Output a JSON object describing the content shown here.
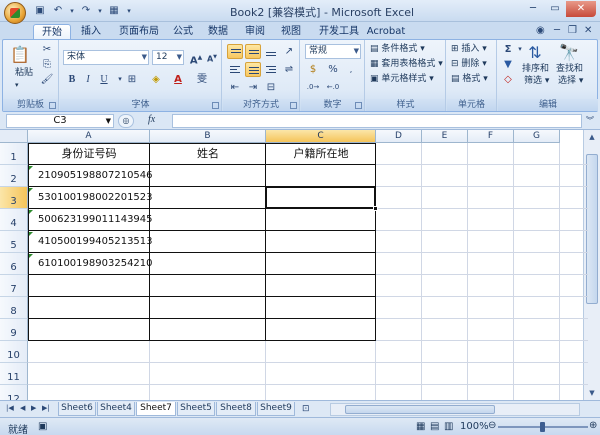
{
  "window": {
    "title": "Book2  [兼容模式] - Microsoft Excel"
  },
  "tabs": [
    "开始",
    "插入",
    "页面布局",
    "公式",
    "数据",
    "审阅",
    "视图",
    "开发工具",
    "Acrobat"
  ],
  "active_tab": "开始",
  "ribbon": {
    "clipboard": {
      "label": "剪贴板",
      "paste": "粘贴"
    },
    "font": {
      "label": "字体",
      "name": "宋体",
      "size": "12",
      "wen": "雯"
    },
    "alignment": {
      "label": "对齐方式"
    },
    "number": {
      "label": "数字",
      "format": "常规",
      "percent": "%"
    },
    "styles": {
      "label": "样式",
      "conditional": "条件格式",
      "table": "套用表格格式",
      "cell": "单元格样式"
    },
    "cells": {
      "label": "单元格",
      "insert": "插入",
      "delete": "删除",
      "format": "格式"
    },
    "editing": {
      "label": "编辑",
      "sort": "排序和",
      "sort2": "筛选",
      "find": "查找和",
      "find2": "选择"
    }
  },
  "formula_bar": {
    "name_box": "C3",
    "fx": "fx",
    "value": ""
  },
  "columns": [
    "A",
    "B",
    "C",
    "D",
    "E",
    "F",
    "G"
  ],
  "rows": [
    "1",
    "2",
    "3",
    "4",
    "5",
    "6",
    "7",
    "8",
    "9",
    "10",
    "11",
    "12"
  ],
  "table": {
    "headers": [
      "身份证号码",
      "姓名",
      "户籍所在地"
    ],
    "ids": [
      "210905198807210546",
      "530100198002201523",
      "500623199011143945",
      "410500199405213513",
      "610100198903254210"
    ]
  },
  "sheet_tabs": [
    "Sheet6",
    "Sheet4",
    "Sheet7",
    "Sheet5",
    "Sheet8",
    "Sheet9"
  ],
  "active_sheet": "Sheet7",
  "status": {
    "ready": "就绪",
    "zoom": "100%"
  },
  "colors": {
    "accent": "#f5c45a",
    "ribbon": "#dfeaf7",
    "green_flag": "#2d8b2d"
  }
}
